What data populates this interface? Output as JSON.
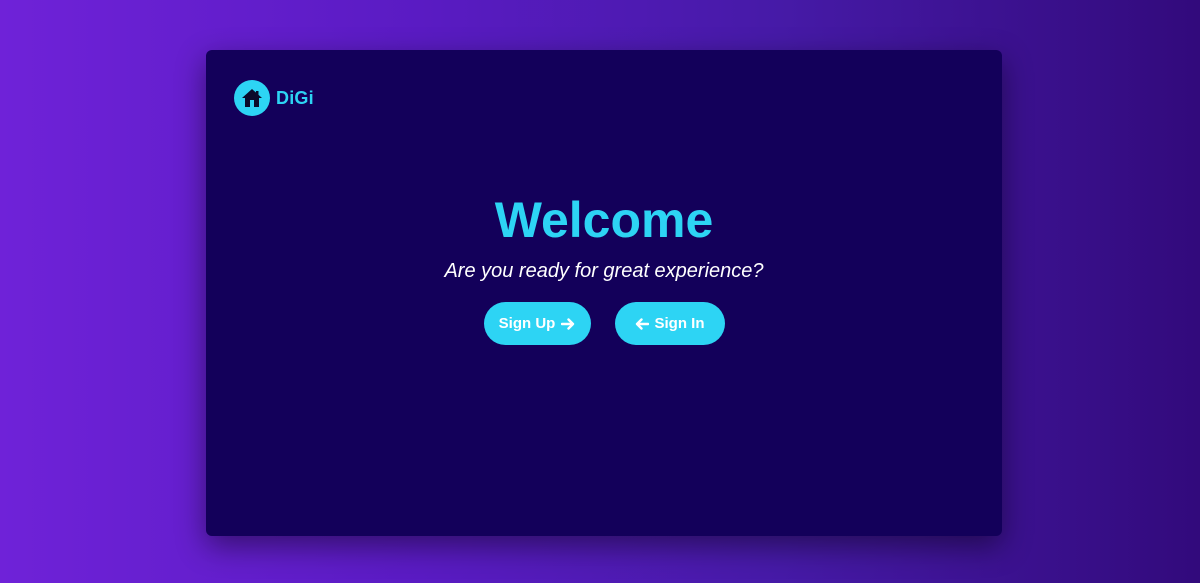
{
  "brand": {
    "name": "DiGi",
    "icon": "house-icon"
  },
  "hero": {
    "title": "Welcome",
    "subtitle": "Are you ready for great experience?"
  },
  "actions": {
    "sign_up_label": "Sign Up",
    "sign_up_icon": "arrow-right-icon",
    "sign_in_label": "Sign In",
    "sign_in_icon": "arrow-left-icon"
  },
  "colors": {
    "accent": "#2dd4f4",
    "card_background": "#13005a",
    "page_gradient_start": "#6f22d8",
    "page_gradient_end": "#320a7c"
  }
}
